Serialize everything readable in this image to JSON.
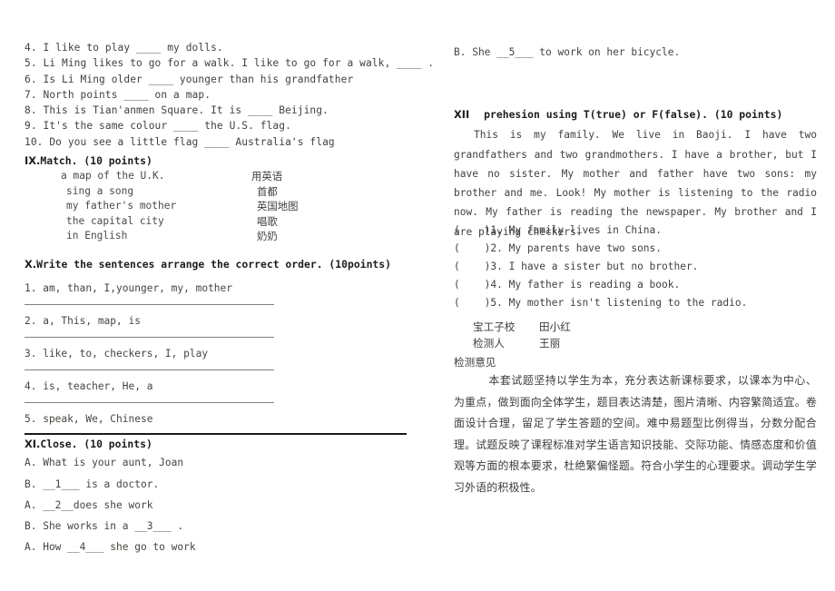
{
  "document": {
    "type": "english-exam-paper",
    "left_column": {
      "fill_in_blanks": [
        "4. I like to play ____ my dolls.",
        "5. Li Ming likes to go for a walk. I like to go for a walk, ____ .",
        "6. Is Li Ming older ____ younger than his grandfather",
        "7. North points ____ on a map.",
        "8. This is Tian'anmen Square. It is ____ Beijing.",
        "9. It's the same colour ____ the U.S. flag.",
        "10. Do you see a little flag ____ Australia's flag"
      ],
      "section_ix": {
        "heading_numeral": "IX.",
        "heading_text": "Match. (10 points)",
        "pairs": [
          {
            "english": "a map of the U.K.",
            "chinese": "用英语"
          },
          {
            "english": "sing a song",
            "chinese": "首都"
          },
          {
            "english": "my father's mother",
            "chinese": "英国地图"
          },
          {
            "english": "the capital city",
            "chinese": "唱歌"
          },
          {
            "english": "in English",
            "chinese": "奶奶"
          }
        ]
      },
      "section_x": {
        "heading_numeral": "X.",
        "heading_text": "Write the sentences arrange the correct order. (10points)",
        "items": [
          "1. am, than, I,younger, my, mother",
          "2. a, This, map, is",
          "3. like, to, checkers, I, play",
          "4. is, teacher, He, a",
          "5. speak, We, Chinese"
        ]
      },
      "section_xi": {
        "heading_numeral": "XI.",
        "heading_text": "Close. (10 points)",
        "lines": [
          "A. What is your aunt, Joan",
          "B. __1___ is a doctor.",
          "A. __2__does she work",
          "B. She works in a __3___ .",
          "A. How __4___ she go to work"
        ]
      }
    },
    "right_column": {
      "continued_line": "B. She __5___ to work on her bicycle.",
      "section_xii": {
        "heading_numeral": "XII",
        "heading_text": "prehesion using T(true) or F(false). (10 points)",
        "passage": "This is my family. We live in Baoji. I have two grandfathers and two grandmothers. I have a brother, but I have no sister. My mother and father have two sons: my brother and me. Look! My mother is listening to the radio now. My father is reading the newspaper. My brother and I are playing checkers.",
        "statements": [
          "(    )1. My family lives in China.",
          "(    )2. My parents have two sons.",
          "(    )3. I have a sister but no brother.",
          "(    )4. My father is reading a book.",
          "(    )5. My mother isn't listening to the radio."
        ]
      },
      "signature": {
        "school_label": "宝工子校",
        "school_value": "田小红",
        "reviewer_label": "检测人",
        "reviewer_value": "王丽",
        "opinion_label": "检测意见"
      },
      "comment": "本套试题坚持以学生为本，充分表达新课标要求，以课本为中心、为重点，做到面向全体学生，题目表达清楚，图片清晰、内容繁简适宜。卷面设计合理，留足了学生答题的空间。难中易题型比例得当，分数分配合理。试题反映了课程标准对学生语言知识技能、交际功能、情感态度和价值观等方面的根本要求，杜绝繁偏怪题。符合小学生的心理要求。调动学生学习外语的积极性。"
    }
  }
}
